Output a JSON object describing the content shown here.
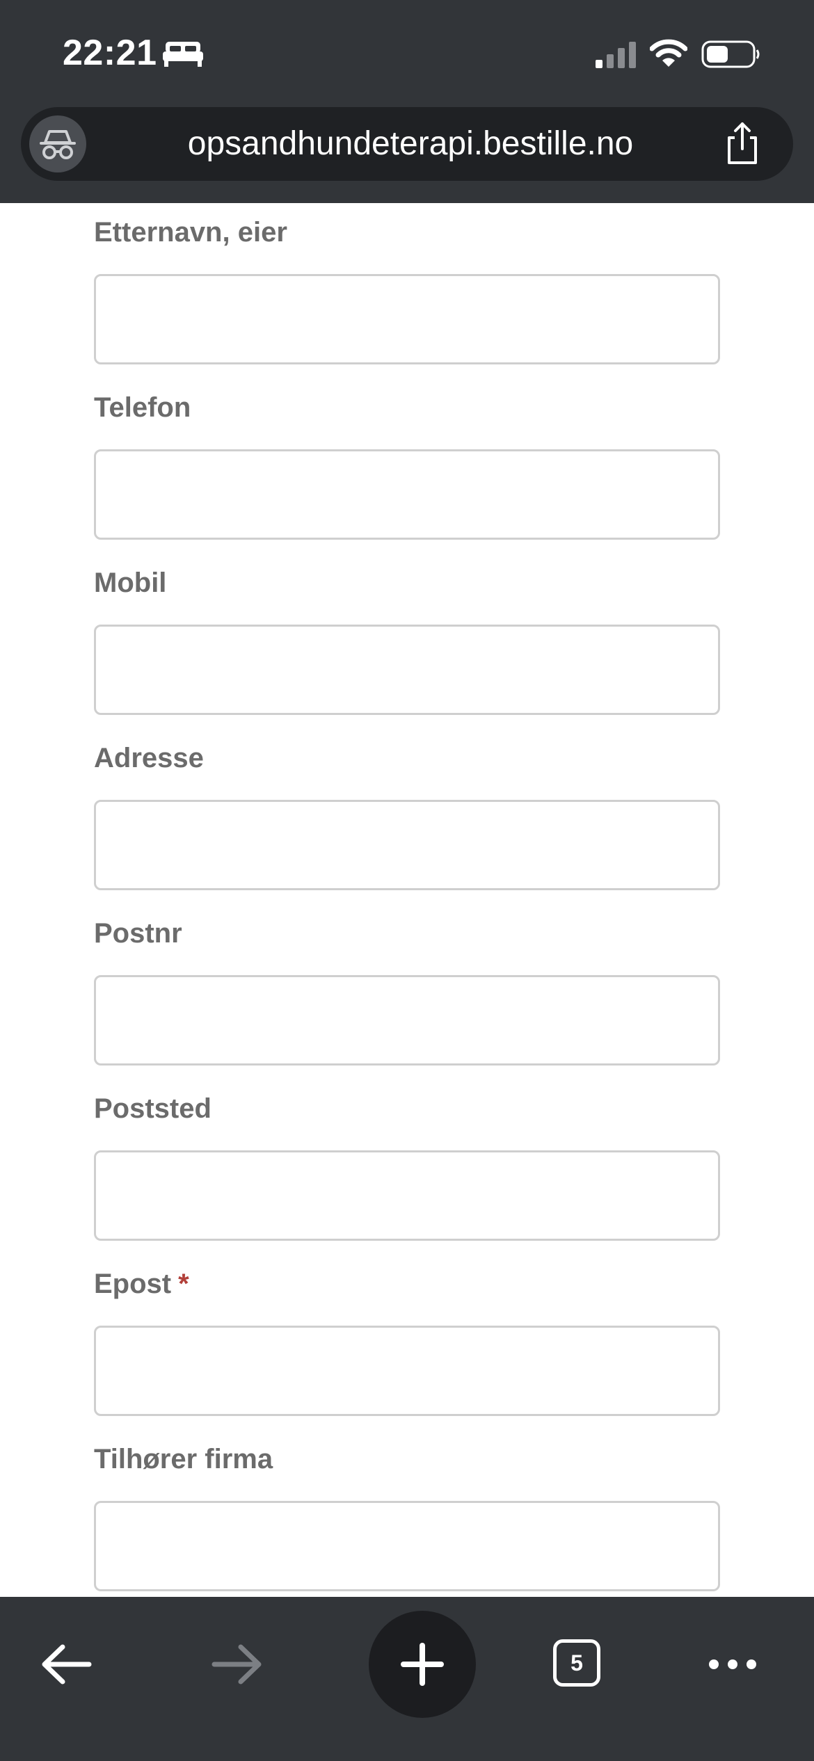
{
  "status_bar": {
    "time": "22:21",
    "icons": [
      "bed-icon",
      "cellular-signal-icon",
      "wifi-icon",
      "battery-icon"
    ]
  },
  "browser": {
    "url": "opsandhundeterapi.bestille.no",
    "incognito_icon": "incognito-icon",
    "share_icon": "share-icon"
  },
  "form": {
    "fields": [
      {
        "label": "Etternavn, eier",
        "value": "",
        "required": false
      },
      {
        "label": "Telefon",
        "value": "",
        "required": false
      },
      {
        "label": "Mobil",
        "value": "",
        "required": false
      },
      {
        "label": "Adresse",
        "value": "",
        "required": false
      },
      {
        "label": "Postnr",
        "value": "",
        "required": false
      },
      {
        "label": "Poststed",
        "value": "",
        "required": false
      },
      {
        "label": "Epost",
        "value": "",
        "required": true,
        "required_mark": "*"
      },
      {
        "label": "Tilhører firma",
        "value": "",
        "required": false
      }
    ]
  },
  "toolbar": {
    "back_icon": "arrow-left-icon",
    "forward_icon": "arrow-right-icon",
    "new_tab_icon": "plus-icon",
    "tab_count": "5",
    "more_icon": "ellipsis-icon"
  },
  "colors": {
    "chrome_bg": "#323539",
    "url_bar_bg": "#1f2124",
    "label_text": "#6b6b6b",
    "required_mark": "#b2403a",
    "input_border": "#cfcfcf"
  }
}
